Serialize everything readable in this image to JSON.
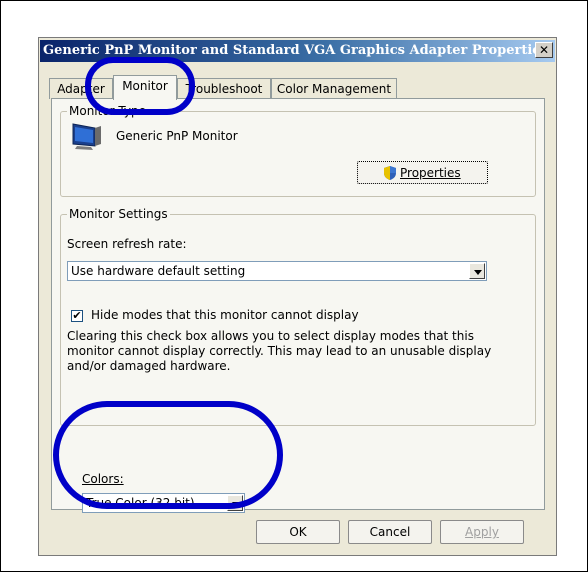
{
  "dialog": {
    "title": "Generic PnP Monitor and Standard VGA Graphics Adapter Properties",
    "close_glyph": "✕"
  },
  "tabs": [
    {
      "label": "Adapter"
    },
    {
      "label": "Monitor",
      "active": true
    },
    {
      "label": "Troubleshoot"
    },
    {
      "label": "Color Management"
    }
  ],
  "monitor_type": {
    "group_label": "Monitor Type",
    "name": "Generic PnP Monitor",
    "icon": "monitor-icon",
    "properties_button": "Properties",
    "properties_icon": "uac-shield-icon"
  },
  "monitor_settings": {
    "group_label": "Monitor Settings",
    "refresh_label": "Screen refresh rate:",
    "refresh_value": "Use hardware default setting",
    "hide_modes_checked": true,
    "hide_modes_label": "Hide modes that this monitor cannot display",
    "description": "Clearing this check box allows you to select display modes that this monitor cannot display correctly. This may lead to an unusable display and/or damaged hardware."
  },
  "colors": {
    "label": "Colors:",
    "value": "True Color (32 bit)"
  },
  "buttons": {
    "ok": "OK",
    "cancel": "Cancel",
    "apply": "Apply"
  },
  "annotation_color": "#0000c8"
}
